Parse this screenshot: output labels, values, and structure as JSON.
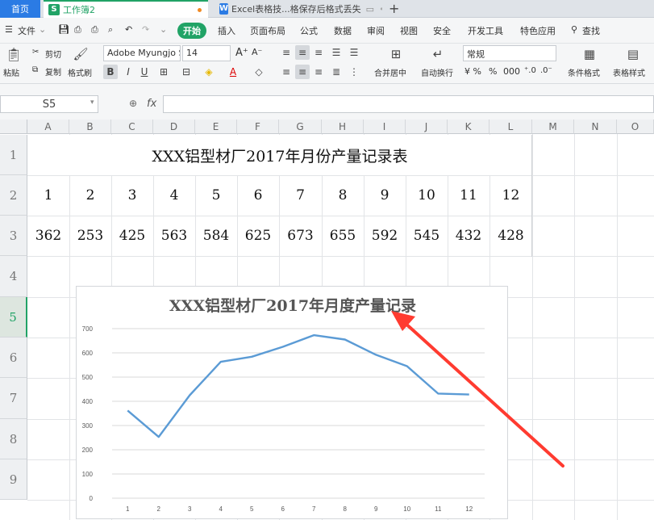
{
  "tabs": {
    "home": "首页",
    "workbook": "工作簿2",
    "document": "Excel表格技...格保存后格式丢失"
  },
  "menu": {
    "file": "文件",
    "start": "开始",
    "items": [
      "插入",
      "页面布局",
      "公式",
      "数据",
      "审阅",
      "视图",
      "安全",
      "开发工具",
      "特色应用"
    ],
    "search": "查找"
  },
  "ribbon": {
    "paste": "粘贴",
    "cut": "剪切",
    "copy": "复制",
    "format_painter": "格式刷",
    "font_name": "Adobe Myungjo S",
    "font_size": "14",
    "merge_center": "合并居中",
    "wrap_text": "自动换行",
    "number_format": "常规",
    "conditional_format": "条件格式",
    "table_style": "表格样式"
  },
  "formula_bar": {
    "name_box": "S5",
    "fx": "fx",
    "value": ""
  },
  "columns": [
    "A",
    "B",
    "C",
    "D",
    "E",
    "F",
    "G",
    "H",
    "I",
    "J",
    "K",
    "L",
    "M",
    "N",
    "O"
  ],
  "rows": [
    "1",
    "2",
    "3",
    "4",
    "5",
    "6",
    "7",
    "8",
    "9"
  ],
  "sheet": {
    "title": "XXX铝型材厂2017年月份产量记录表",
    "months": [
      "1",
      "2",
      "3",
      "4",
      "5",
      "6",
      "7",
      "8",
      "9",
      "10",
      "11",
      "12"
    ],
    "output": [
      "362",
      "253",
      "425",
      "563",
      "584",
      "625",
      "673",
      "655",
      "592",
      "545",
      "432",
      "428"
    ]
  },
  "chart_data": {
    "type": "line",
    "title": "XXX铝型材厂2017年月度产量记录",
    "categories": [
      "1",
      "2",
      "3",
      "4",
      "5",
      "6",
      "7",
      "8",
      "9",
      "10",
      "11",
      "12"
    ],
    "values": [
      362,
      253,
      425,
      563,
      584,
      625,
      673,
      655,
      592,
      545,
      432,
      428
    ],
    "yticks": [
      "0",
      "100",
      "200",
      "300",
      "400",
      "500",
      "600",
      "700"
    ],
    "ylim": [
      0,
      700
    ],
    "grid": true,
    "line_color": "#5b9bd5"
  },
  "colors": {
    "accent": "#21a366",
    "arrow": "#ff3b30"
  }
}
